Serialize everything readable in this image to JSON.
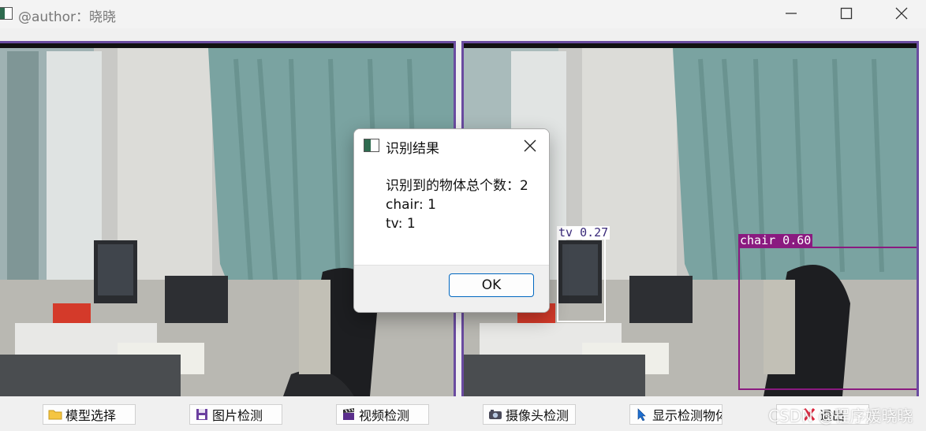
{
  "window": {
    "title": "@author：晓晓"
  },
  "detections": [
    {
      "label": "tv 0.27",
      "color": "#ffffff"
    },
    {
      "label": "chair 0.60",
      "color": "#8a1a80"
    }
  ],
  "toolbar": {
    "buttons": [
      {
        "label": "模型选择",
        "icon": "folder-icon"
      },
      {
        "label": "图片检测",
        "icon": "save-icon"
      },
      {
        "label": "视频检测",
        "icon": "clapperboard-icon"
      },
      {
        "label": "摄像头检测",
        "icon": "camera-icon"
      },
      {
        "label": "显示检测物体",
        "icon": "pointer-icon"
      },
      {
        "label": "退出",
        "icon": "exit-icon"
      }
    ]
  },
  "dialog": {
    "title": "识别结果",
    "lines": [
      "识别到的物体总个数：2",
      "chair: 1",
      "tv: 1"
    ],
    "ok_label": "OK"
  },
  "watermark": "CSDN @程序媛晓晓",
  "colors": {
    "pane_border": "#6a4ba0",
    "chair_box": "#8a1a80",
    "tv_box": "#ffffff",
    "ok_border": "#0067c0"
  }
}
